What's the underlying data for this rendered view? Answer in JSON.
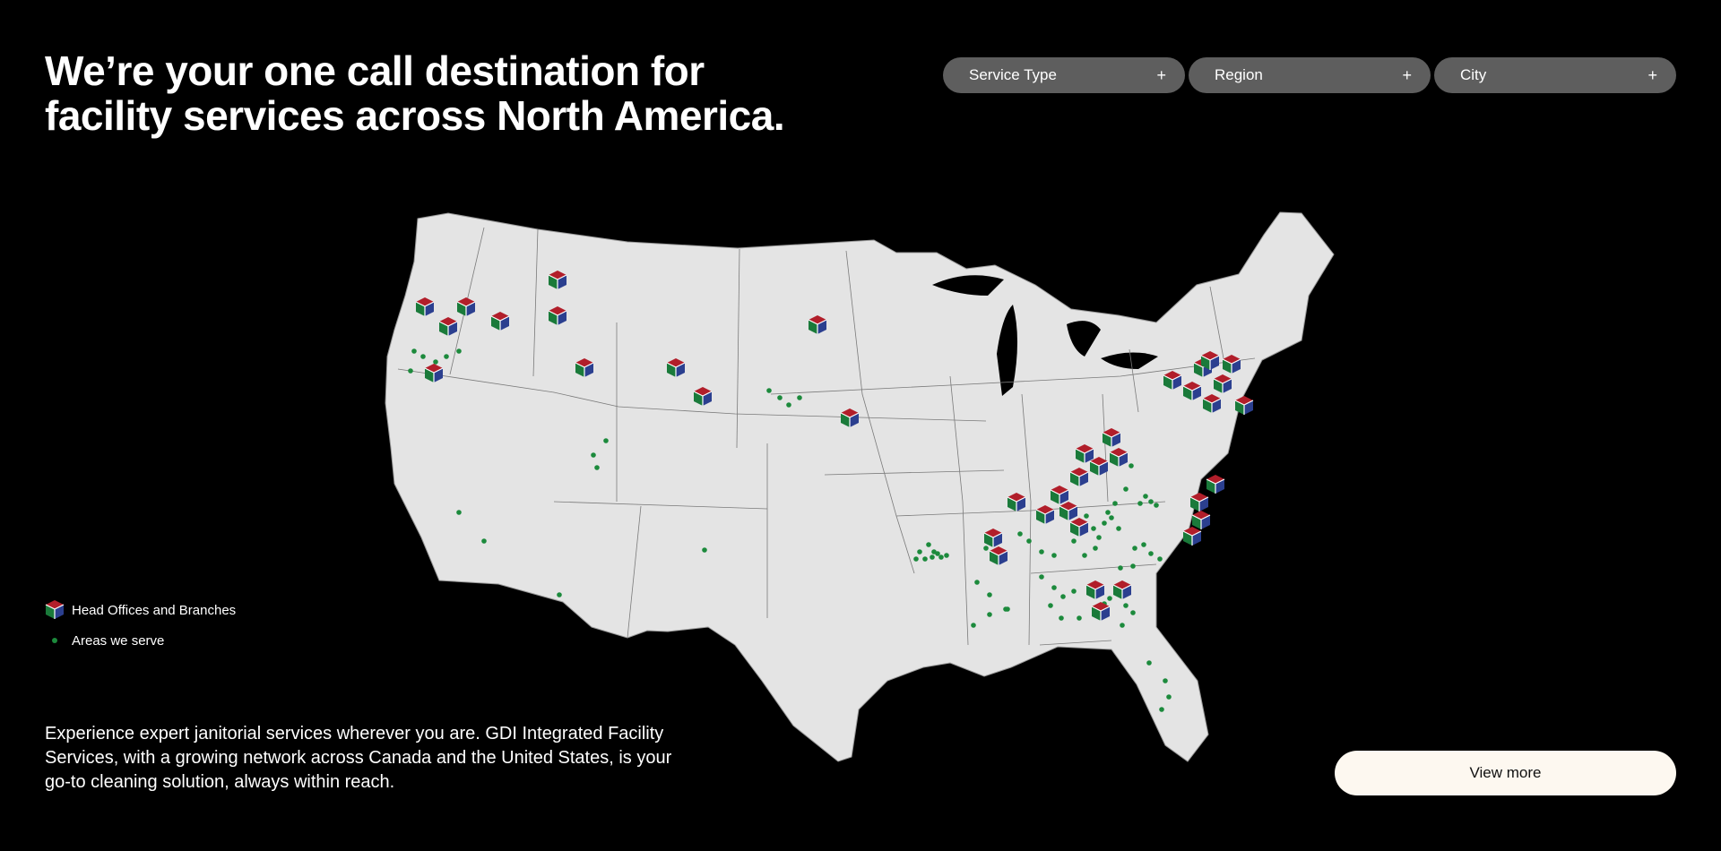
{
  "headline": {
    "line1": "We’re your one call destination for",
    "line2": "facility services across North America."
  },
  "filters": [
    {
      "label": "Service Type",
      "icon": "+"
    },
    {
      "label": "Region",
      "icon": "+"
    },
    {
      "label": "City",
      "icon": "+"
    }
  ],
  "legend": {
    "offices_label": "Head Offices and Branches",
    "areas_label": "Areas we serve"
  },
  "description": "Experience expert janitorial services wherever you are. GDI Integrated Facility Services, with a growing network across Canada and the United States, is your go-to cleaning solution, always within reach.",
  "cta": {
    "label": "View more"
  },
  "colors": {
    "background": "#000000",
    "map_fill": "#e4e4e4",
    "filter_bg": "#5e5e5e",
    "marker_red": "#b11e2a",
    "marker_blue": "#2b3f8f",
    "marker_green": "#1a7a3a",
    "dot_green": "#1c8a3c",
    "button_bg": "#fdf8f0"
  }
}
